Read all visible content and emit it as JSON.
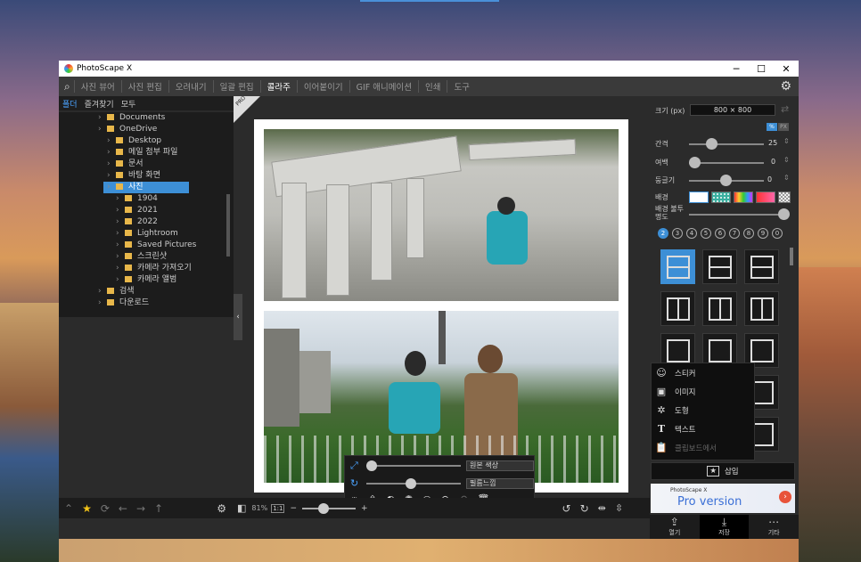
{
  "app": {
    "title": "PhotoScape X"
  },
  "window_controls": {
    "minimize": "─",
    "maximize": "☐",
    "close": "✕"
  },
  "menu": [
    "사진 뷰어",
    "사진 편집",
    "오려내기",
    "일괄 편집",
    "콜라주",
    "이어붙이기",
    "GIF 애니메이션",
    "인쇄",
    "도구"
  ],
  "menu_active": "콜라주",
  "left_tabs": [
    "폴더",
    "즐겨찾기",
    "모두"
  ],
  "tree": [
    {
      "label": "Documents",
      "indent": 1
    },
    {
      "label": "OneDrive",
      "indent": 1
    },
    {
      "label": "Desktop",
      "indent": 2
    },
    {
      "label": "메일 첨부 파일",
      "indent": 2
    },
    {
      "label": "문서",
      "indent": 2
    },
    {
      "label": "바탕 화면",
      "indent": 2
    },
    {
      "label": "사진",
      "indent": 2,
      "selected": true
    },
    {
      "label": "1904",
      "indent": 3
    },
    {
      "label": "2021",
      "indent": 3
    },
    {
      "label": "2022",
      "indent": 3
    },
    {
      "label": "Lightroom",
      "indent": 3
    },
    {
      "label": "Saved Pictures",
      "indent": 3
    },
    {
      "label": "스크린샷",
      "indent": 3
    },
    {
      "label": "카메라 가져오기",
      "indent": 3
    },
    {
      "label": "카메라 앨범",
      "indent": 3
    },
    {
      "label": "검색",
      "indent": 1
    },
    {
      "label": "다운로드",
      "indent": 1
    }
  ],
  "pro_badge": "PRO",
  "floater": {
    "select1": "원본 색상",
    "select2": "필름느낌"
  },
  "zoom": {
    "percent": "81%",
    "one": "1:1",
    "minus": "−",
    "plus": "+"
  },
  "right": {
    "size_label": "크기 (px)",
    "size_value": "800 × 800",
    "unit_badge_pct": "%",
    "unit_badge_px": "PX",
    "spacing_label": "간격",
    "spacing_value": "25",
    "margin_label": "여백",
    "margin_value": "0",
    "round_label": "둥글기",
    "round_value": "0",
    "bg_label": "배경",
    "bg_opacity_label": "배경 불투명도",
    "pages": [
      "2",
      "3",
      "4",
      "5",
      "6",
      "7",
      "8",
      "9",
      "0"
    ],
    "insert_menu": [
      {
        "icon": "sticker-icon",
        "label": "스티커"
      },
      {
        "icon": "image-icon",
        "label": "이미지"
      },
      {
        "icon": "shape-icon",
        "label": "도형"
      },
      {
        "icon": "text-icon",
        "label": "텍스트"
      },
      {
        "icon": "clipboard-icon",
        "label": "클립보드에서"
      }
    ],
    "insert_button": "삽입",
    "ad_line1": "PhotoScape X",
    "ad_line2": "Pro version",
    "bottom": [
      {
        "icon": "open-icon",
        "label": "열기"
      },
      {
        "icon": "save-icon",
        "label": "저장"
      },
      {
        "icon": "more-icon",
        "label": "기타"
      }
    ]
  },
  "colors": {
    "accent": "#3d8fd6",
    "panel": "#2b2b2b"
  }
}
